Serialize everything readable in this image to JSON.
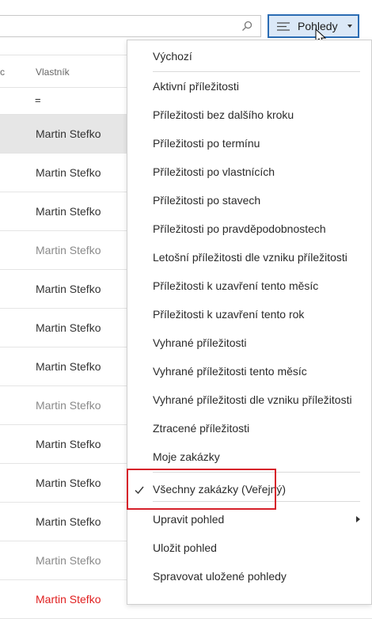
{
  "toolbar": {
    "views_label": "Pohledy",
    "views_icon": "list-icon",
    "search_icon": "search-icon"
  },
  "table": {
    "columns": [
      "c",
      "Vlastník"
    ],
    "filter_symbol": "=",
    "rows": [
      {
        "owner": "Martin Stefko",
        "style": "selected"
      },
      {
        "owner": "Martin Stefko",
        "style": "normal"
      },
      {
        "owner": "Martin Stefko",
        "style": "normal"
      },
      {
        "owner": "Martin Stefko",
        "style": "gray"
      },
      {
        "owner": "Martin Stefko",
        "style": "normal"
      },
      {
        "owner": "Martin Stefko",
        "style": "normal"
      },
      {
        "owner": "Martin Stefko",
        "style": "normal"
      },
      {
        "owner": "Martin Stefko",
        "style": "gray"
      },
      {
        "owner": "Martin Stefko",
        "style": "normal"
      },
      {
        "owner": "Martin Stefko",
        "style": "normal"
      },
      {
        "owner": "Martin Stefko",
        "style": "normal"
      },
      {
        "owner": "Martin Stefko",
        "style": "gray"
      },
      {
        "owner": "Martin Stefko",
        "style": "red"
      }
    ]
  },
  "menu": {
    "default_view": "Výchozí",
    "views": [
      "Aktivní příležitosti",
      "Příležitosti bez dalšího kroku",
      "Příležitosti po termínu",
      "Příležitosti po vlastnících",
      "Příležitosti po stavech",
      "Příležitosti po pravděpodobnostech",
      "Letošní příležitosti dle vzniku příležitosti",
      "Příležitosti k uzavření tento měsíc",
      "Příležitosti k uzavření tento rok",
      "Vyhrané příležitosti",
      "Vyhrané příležitosti tento měsíc",
      "Vyhrané příležitosti dle vzniku příležitosti",
      "Ztracené příležitosti",
      "Moje zakázky"
    ],
    "selected_view": "Všechny zakázky (Veřejný)",
    "actions": {
      "edit": "Upravit pohled",
      "save": "Uložit pohled",
      "manage": "Spravovat uložené pohledy"
    }
  },
  "colors": {
    "accent_border": "#2b6cb3",
    "accent_fill": "#dbe8f7",
    "highlight": "#d6202a",
    "red_text": "#e01f1f"
  }
}
